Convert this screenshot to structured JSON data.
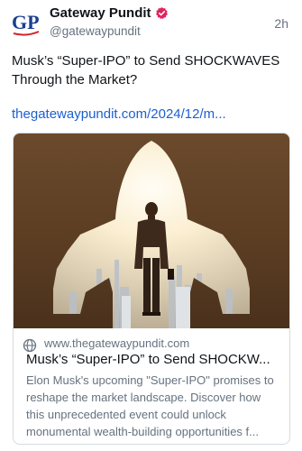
{
  "post": {
    "author_initials": "GP",
    "author_name": "Gateway Pundit",
    "handle": "@gatewaypundit",
    "timestamp": "2h",
    "text": "Musk’s “Super-IPO” to Send SHOCKWAVES Through the Market?",
    "link_text": "thegatewaypundit.com/2024/12/m..."
  },
  "card": {
    "domain": "www.thegatewaypundit.com",
    "title": "Musk’s “Super-IPO” to Send SHOCKW...",
    "description": "Elon Musk's upcoming \"Super-IPO\" promises to reshape the market landscape. Discover how this unprecedented event could unlock monumental wealth-building opportunities f..."
  },
  "colors": {
    "link": "#1d5fd1",
    "verified_badge": "#e0245e",
    "secondary_text": "#66727f",
    "card_border": "#d4dbe2",
    "logo_blue": "#1a3f8f",
    "logo_red": "#d2232a"
  },
  "icons": {
    "verified": "verified-badge-icon",
    "link": "globe-icon"
  }
}
